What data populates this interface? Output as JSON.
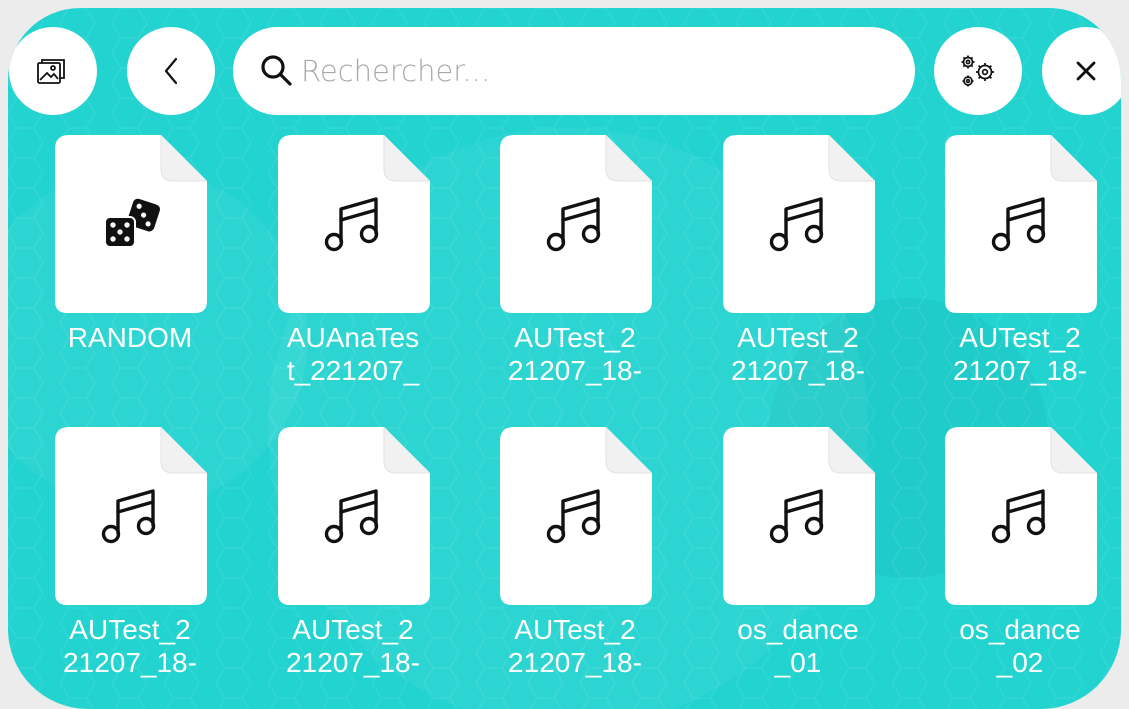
{
  "toolbar": {
    "gallery_icon": "gallery-icon",
    "back_icon": "chevron-left-icon",
    "search_placeholder": "Rechercher...",
    "settings_icon": "gears-icon",
    "close_icon": "close-icon"
  },
  "colors": {
    "background": "#22d3d0",
    "card": "#ffffff",
    "label": "#ffffff",
    "icon": "#111111"
  },
  "files": [
    {
      "line1": "RANDOM",
      "line2": "",
      "icon": "dice-icon"
    },
    {
      "line1": "AUAnaTes",
      "line2": "t_221207_",
      "icon": "music-note-icon"
    },
    {
      "line1": "AUTest_2",
      "line2": "21207_18-",
      "icon": "music-note-icon"
    },
    {
      "line1": "AUTest_2",
      "line2": "21207_18-",
      "icon": "music-note-icon"
    },
    {
      "line1": "AUTest_2",
      "line2": "21207_18-",
      "icon": "music-note-icon"
    },
    {
      "line1": "AUTest_2",
      "line2": "21207_18-",
      "icon": "music-note-icon"
    },
    {
      "line1": "AUTest_2",
      "line2": "21207_18-",
      "icon": "music-note-icon"
    },
    {
      "line1": "AUTest_2",
      "line2": "21207_18-",
      "icon": "music-note-icon"
    },
    {
      "line1": "os_dance",
      "line2": "_01",
      "icon": "music-note-icon"
    },
    {
      "line1": "os_dance",
      "line2": "_02",
      "icon": "music-note-icon"
    }
  ]
}
